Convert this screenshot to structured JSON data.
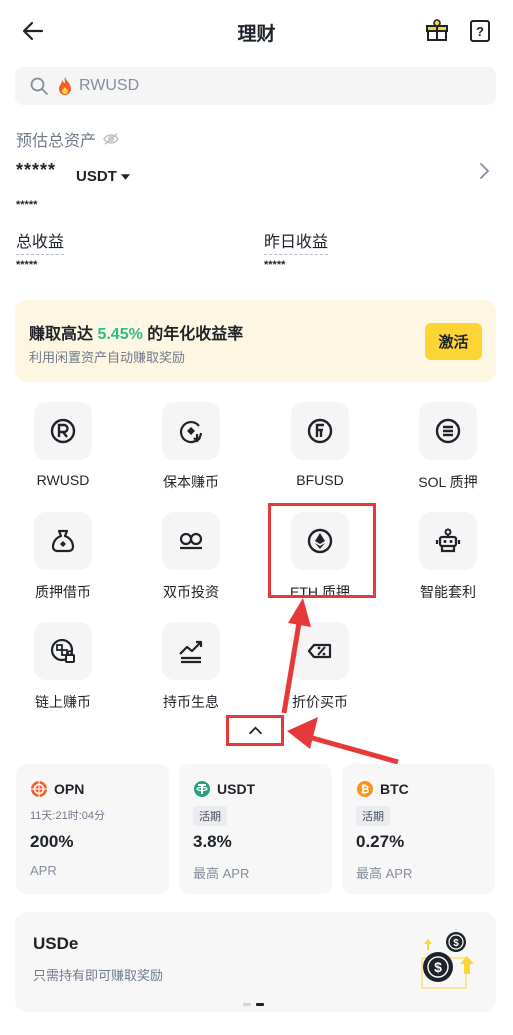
{
  "header": {
    "title": "理财"
  },
  "search": {
    "placeholder": "RWUSD"
  },
  "assets": {
    "label": "预估总资产",
    "value": "*****",
    "unit": "USDT",
    "sub_value": "*****",
    "total_earnings_label": "总收益",
    "total_earnings_value": "*****",
    "yesterday_earnings_label": "昨日收益",
    "yesterday_earnings_value": "*****"
  },
  "promo": {
    "title_prefix": "赚取高达 ",
    "rate": "5.45%",
    "title_suffix": " 的年化收益率",
    "subtitle": "利用闲置资产自动赚取奖励",
    "button": "激活",
    "rate_color": "#2ebd85",
    "button_color": "#fcd535"
  },
  "products": [
    {
      "label": "RWUSD",
      "icon": "rwusd-icon"
    },
    {
      "label": "保本赚币",
      "icon": "principal-protected-icon"
    },
    {
      "label": "BFUSD",
      "icon": "bfusd-icon"
    },
    {
      "label": "SOL 质押",
      "icon": "sol-staking-icon"
    },
    {
      "label": "质押借币",
      "icon": "loan-bag-icon"
    },
    {
      "label": "双币投资",
      "icon": "dual-investment-icon"
    },
    {
      "label": "ETH 质押",
      "icon": "eth-staking-icon"
    },
    {
      "label": "智能套利",
      "icon": "robot-icon"
    },
    {
      "label": "链上赚币",
      "icon": "onchain-earn-icon"
    },
    {
      "label": "持币生息",
      "icon": "hold-earn-icon"
    },
    {
      "label": "折价买币",
      "icon": "discount-buy-icon"
    }
  ],
  "cards": [
    {
      "coin": "OPN",
      "tag": "11天:21时:04分",
      "value": "200%",
      "apr_label": "APR",
      "coin_color": "#f0612b"
    },
    {
      "coin": "USDT",
      "tag": "活期",
      "value": "3.8%",
      "apr_label": "最高 APR",
      "coin_color": "#26a17b"
    },
    {
      "coin": "BTC",
      "tag": "活期",
      "value": "0.27%",
      "apr_label": "最高 APR",
      "coin_color": "#f7931a"
    }
  ],
  "usde": {
    "title": "USDe",
    "subtitle": "只需持有即可赚取奖励"
  },
  "annotation_color": "#e8393a"
}
